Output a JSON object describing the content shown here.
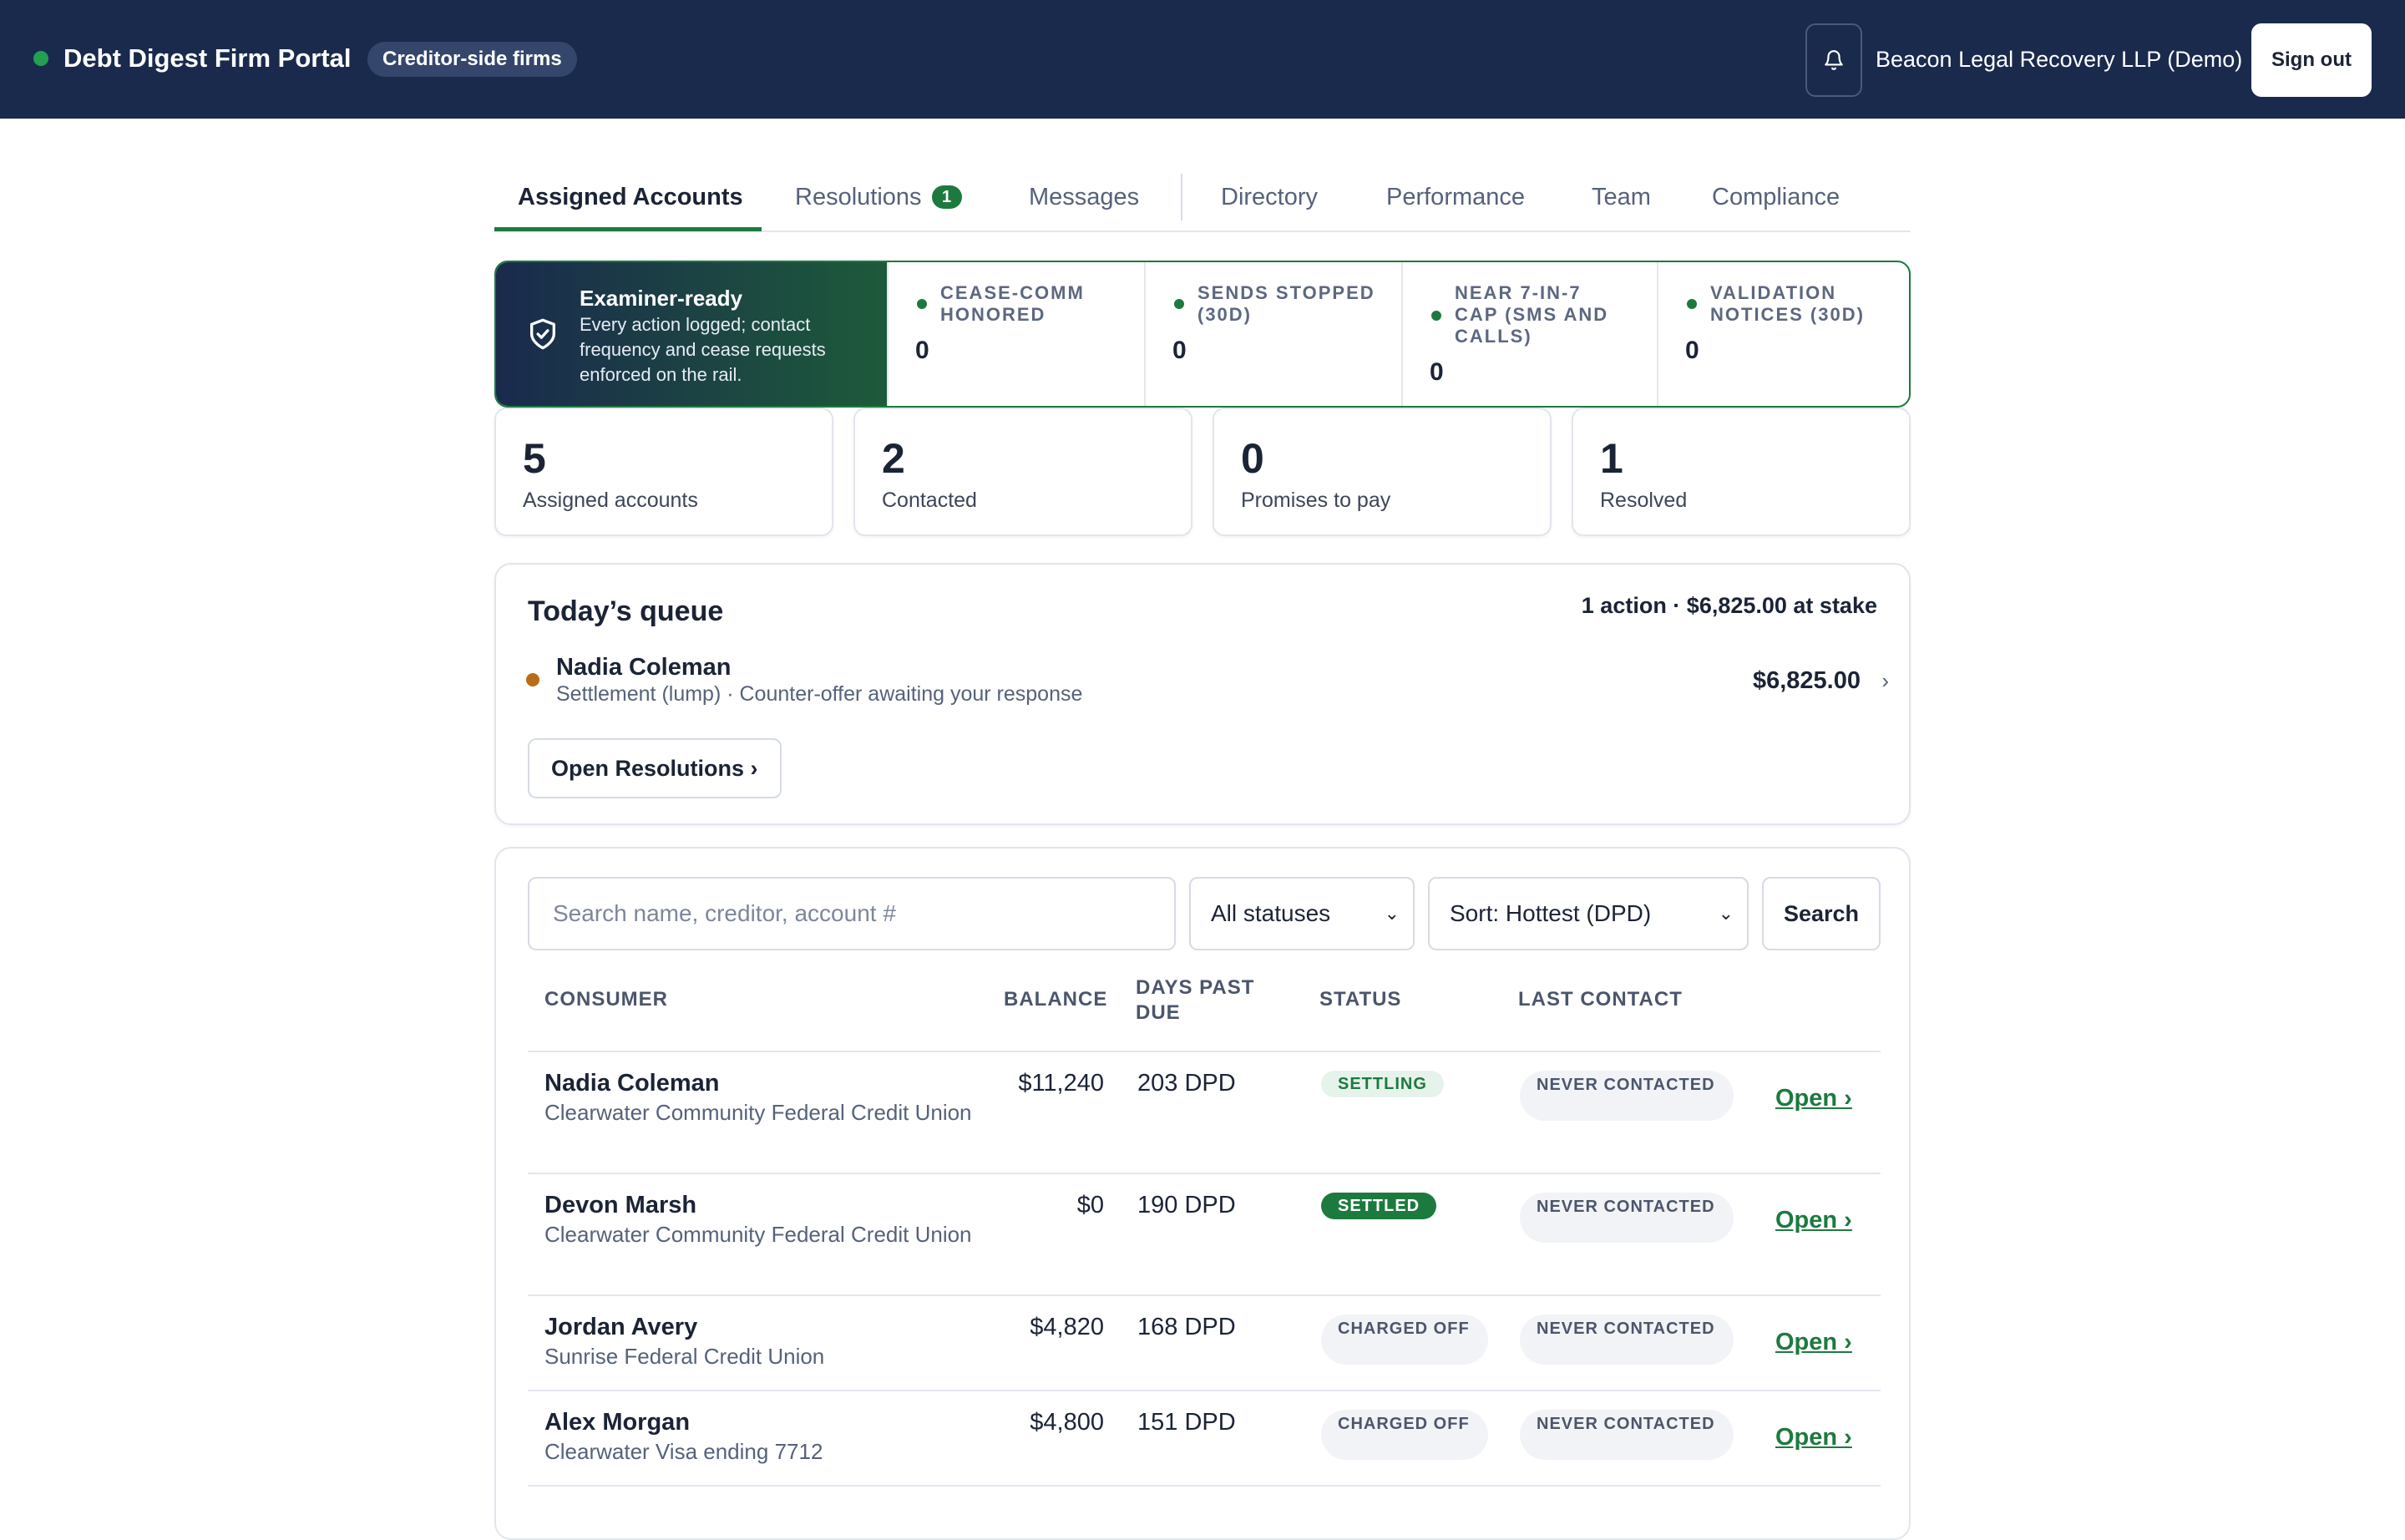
{
  "topbar": {
    "title": "Debt Digest Firm Portal",
    "pill": "Creditor-side firms",
    "firm_name": "Beacon Legal Recovery LLP (Demo)",
    "sign_out": "Sign out"
  },
  "tabs": {
    "assigned": "Assigned Accounts",
    "resolutions": "Resolutions",
    "resolutions_badge": "1",
    "messages": "Messages",
    "directory": "Directory",
    "performance": "Performance",
    "team": "Team",
    "compliance": "Compliance"
  },
  "compliance": {
    "title": "Examiner-ready",
    "description": "Every action logged; contact frequency and cease requests enforced on the rail.",
    "stats": [
      {
        "label": "Cease-comm honored",
        "value": "0"
      },
      {
        "label": "Sends stopped (30d)",
        "value": "0"
      },
      {
        "label": "Near 7-in-7 cap (SMS and calls)",
        "value": "0"
      },
      {
        "label": "Validation notices (30d)",
        "value": "0"
      }
    ]
  },
  "metrics": [
    {
      "value": "5",
      "label": "Assigned accounts"
    },
    {
      "value": "2",
      "label": "Contacted"
    },
    {
      "value": "0",
      "label": "Promises to pay"
    },
    {
      "value": "1",
      "label": "Resolved"
    }
  ],
  "queue": {
    "title": "Today’s queue",
    "summary": "1 action · $6,825.00 at stake",
    "item": {
      "name": "Nadia Coleman",
      "detail": "Settlement (lump) · Counter-offer awaiting your response",
      "amount": "$6,825.00"
    },
    "open_button": "Open Resolutions ›"
  },
  "accounts": {
    "search_placeholder": "Search name, creditor, account #",
    "status_filter": "All statuses",
    "sort": "Sort: Hottest (DPD)",
    "search_button": "Search",
    "columns": {
      "consumer": "Consumer",
      "balance": "Balance",
      "dpd": "Days past due",
      "status": "Status",
      "last_contact": "Last contact"
    },
    "rows": [
      {
        "name": "Nadia Coleman",
        "creditor": "Clearwater Community Federal Credit Union",
        "balance": "$11,240",
        "dpd": "203 DPD",
        "status": "Settling",
        "last_contact": "Never contacted",
        "action": "Open ›"
      },
      {
        "name": "Devon Marsh",
        "creditor": "Clearwater Community Federal Credit Union",
        "balance": "$0",
        "dpd": "190 DPD",
        "status": "Settled",
        "last_contact": "Never contacted",
        "action": "Open ›"
      },
      {
        "name": "Jordan Avery",
        "creditor": "Sunrise Federal Credit Union",
        "balance": "$4,820",
        "dpd": "168 DPD",
        "status": "Charged off",
        "last_contact": "Never contacted",
        "action": "Open ›"
      },
      {
        "name": "Alex Morgan",
        "creditor": "Clearwater Visa ending 7712",
        "balance": "$4,800",
        "dpd": "151 DPD",
        "status": "Charged off",
        "last_contact": "Never contacted",
        "action": "Open ›"
      }
    ]
  },
  "colors": {
    "navy": "#1a2a4d",
    "accent_green": "#1d7a3f",
    "queue_dot": "#b86d17"
  }
}
